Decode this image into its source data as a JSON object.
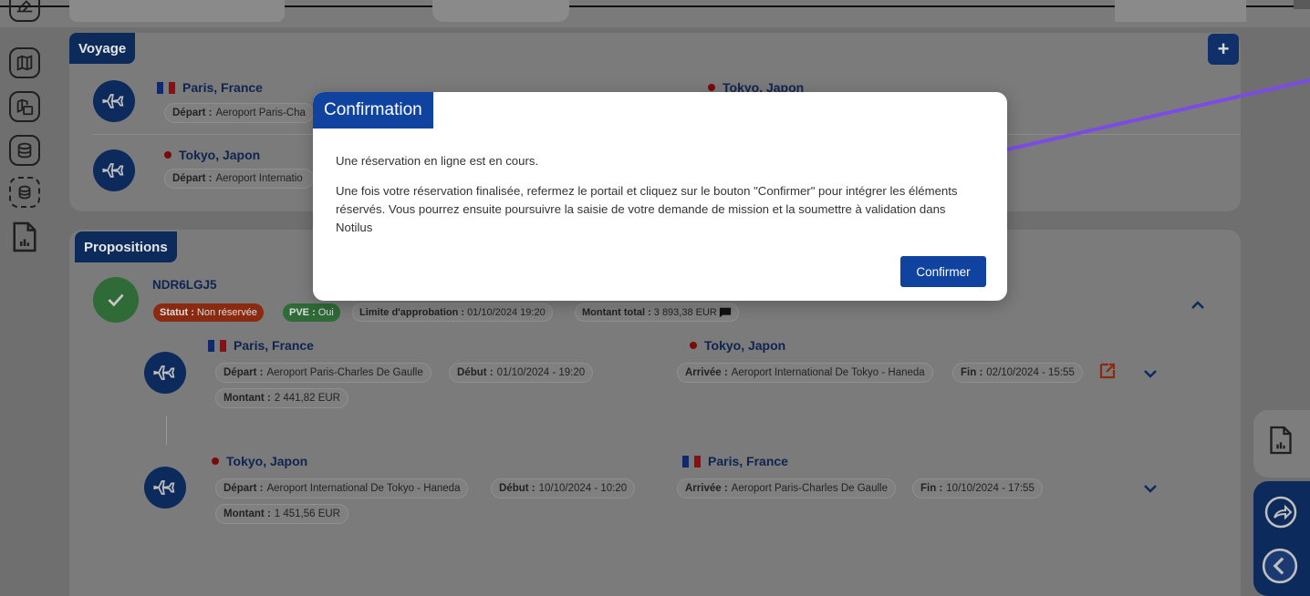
{
  "voyage": {
    "title": "Voyage",
    "add_label": "+",
    "rows": [
      {
        "from_city": "Paris, France",
        "depart_label": "Départ :",
        "depart_value": "Aeroport Paris-Cha",
        "to_city": "Tokyo, Japon"
      },
      {
        "from_city": "Tokyo, Japon",
        "depart_label": "Départ :",
        "depart_value": "Aeroport Internatio"
      }
    ]
  },
  "propositions": {
    "title": "Propositions",
    "proposal": {
      "code": "NDR6LGJ5",
      "statut_label": "Statut :",
      "statut_value": "Non réservée",
      "pve_label": "PVE :",
      "pve_value": "Oui",
      "limite_label": "Limite d'approbation :",
      "limite_value": "01/10/2024 19:20",
      "montant_total_label": "Montant total :",
      "montant_total_value": "3 893,38 EUR"
    },
    "legs": [
      {
        "from_city": "Paris, France",
        "depart_label": "Départ :",
        "depart_value": "Aeroport Paris-Charles De Gaulle",
        "debut_label": "Début :",
        "debut_value": "01/10/2024 - 19:20",
        "montant_label": "Montant :",
        "montant_value": "2 441,82 EUR",
        "to_city": "Tokyo, Japon",
        "arrivee_label": "Arrivée :",
        "arrivee_value": "Aeroport International De Tokyo - Haneda",
        "fin_label": "Fin :",
        "fin_value": "02/10/2024 - 15:55"
      },
      {
        "from_city": "Tokyo, Japon",
        "depart_label": "Départ :",
        "depart_value": "Aeroport International De Tokyo - Haneda",
        "debut_label": "Début :",
        "debut_value": "10/10/2024 - 10:20",
        "montant_label": "Montant :",
        "montant_value": "1 451,56 EUR",
        "to_city": "Paris, France",
        "arrivee_label": "Arrivée :",
        "arrivee_value": "Aeroport Paris-Charles De Gaulle",
        "fin_label": "Fin :",
        "fin_value": "10/10/2024 - 17:55"
      }
    ]
  },
  "modal": {
    "title": "Confirmation",
    "line1": "Une réservation en ligne est en cours.",
    "line2": "Une fois votre réservation finalisée, refermez le portail et cliquez sur le bouton \"Confirmer\" pour intégrer les éléments réservés. Vous pourrez ensuite poursuivre la saisie de votre demande de mission et la soumettre à validation dans Notilus",
    "confirm_label": "Confirmer"
  },
  "colors": {
    "navy": "#0d2a5c",
    "modal_blue": "#1043a0",
    "status_red": "#8a2a10",
    "status_green": "#2f6b36",
    "annotation_arrow": "#7b4be6"
  },
  "icons": [
    "map-icon",
    "calendar-map-icon",
    "coins-icon",
    "coins-dashed-icon",
    "report-icon",
    "plane-icon",
    "check-icon",
    "chat-icon",
    "external-link-icon",
    "chevron-up-icon",
    "chevron-down-icon",
    "share-icon",
    "back-icon"
  ]
}
